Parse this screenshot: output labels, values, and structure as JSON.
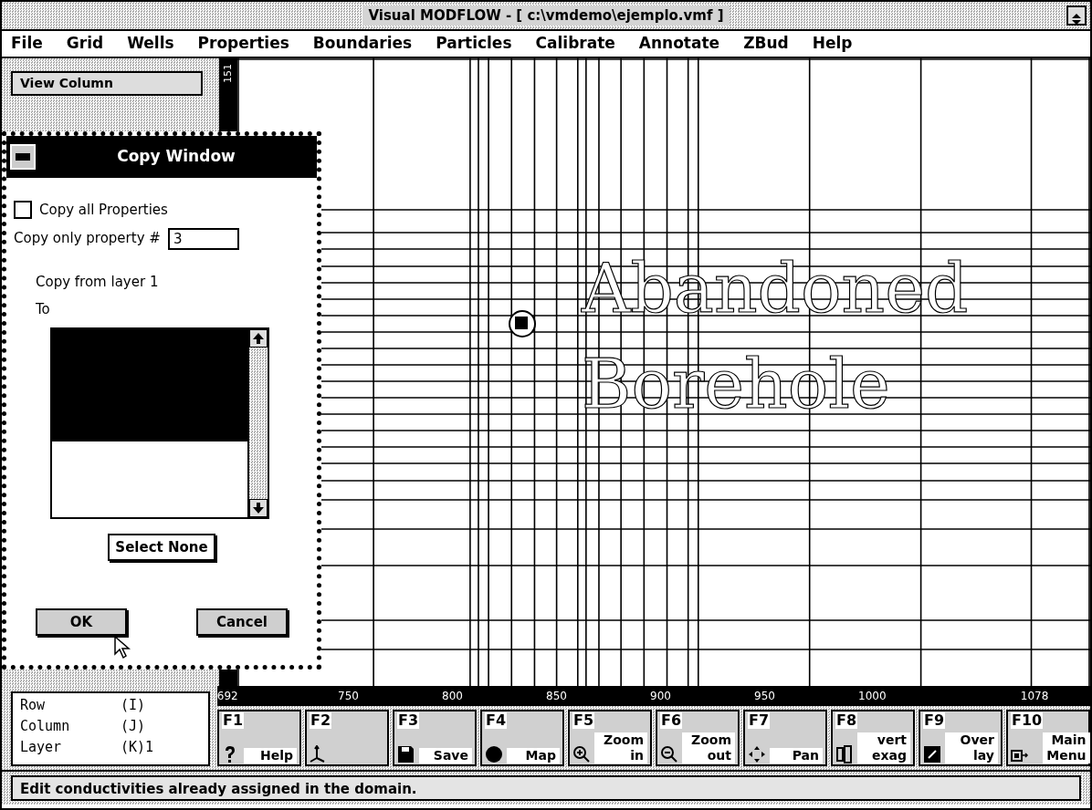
{
  "window": {
    "title": "Visual MODFLOW - [ c:\\vmdemo\\ejemplo.vmf ]"
  },
  "menu": [
    {
      "label": "File"
    },
    {
      "label": "Grid"
    },
    {
      "label": "Wells"
    },
    {
      "label": "Properties"
    },
    {
      "label": "Boundaries"
    },
    {
      "label": "Particles"
    },
    {
      "label": "Calibrate"
    },
    {
      "label": "Annotate"
    },
    {
      "label": "ZBud"
    },
    {
      "label": "Help"
    }
  ],
  "left_panel": {
    "view_button": "View Column"
  },
  "grid_view": {
    "row_axis_label": "151",
    "annotations": [
      "Abandoned",
      "Borehole"
    ],
    "x_axis_labels": [
      "692",
      "750",
      "800",
      "850",
      "900",
      "950",
      "1000",
      "1078"
    ]
  },
  "copy_window": {
    "title": "Copy Window",
    "copy_all": {
      "label": "Copy all Properties",
      "checked": false
    },
    "property_field": {
      "label": "Copy only property #",
      "value": "3"
    },
    "from_text": "Copy from layer 1",
    "to_label": "To",
    "buttons": [
      {
        "label": "Select None",
        "kind": "select"
      },
      {
        "label": "OK",
        "kind": "ok"
      },
      {
        "label": "Cancel",
        "kind": "cancel"
      }
    ]
  },
  "coordinates": [
    {
      "label": "Row",
      "value": "(I)"
    },
    {
      "label": "Column",
      "value": "(J)"
    },
    {
      "label": "Layer",
      "value": "(K)1"
    }
  ],
  "function_keys": [
    {
      "key": "F1",
      "label": [
        "Help"
      ],
      "kind": "help"
    },
    {
      "key": "F2",
      "kind": "axes"
    },
    {
      "key": "F3",
      "label": [
        "Save"
      ],
      "kind": "save"
    },
    {
      "key": "F4",
      "label": [
        "Map"
      ],
      "kind": "map"
    },
    {
      "key": "F5",
      "label": [
        "Zoom",
        "in"
      ],
      "kind": "zoomin"
    },
    {
      "key": "F6",
      "label": [
        "Zoom",
        "out"
      ],
      "kind": "zoomout"
    },
    {
      "key": "F7",
      "label": [
        "Pan"
      ],
      "kind": "pan"
    },
    {
      "key": "F8",
      "label": [
        "vert",
        "exag"
      ],
      "kind": "exag"
    },
    {
      "key": "F9",
      "label": [
        "Over",
        "lay"
      ],
      "kind": "overlay"
    },
    {
      "key": "F10",
      "label": [
        "Main",
        "Menu"
      ],
      "kind": "menu"
    }
  ],
  "status_bar": "Edit conductivities already assigned in the domain."
}
